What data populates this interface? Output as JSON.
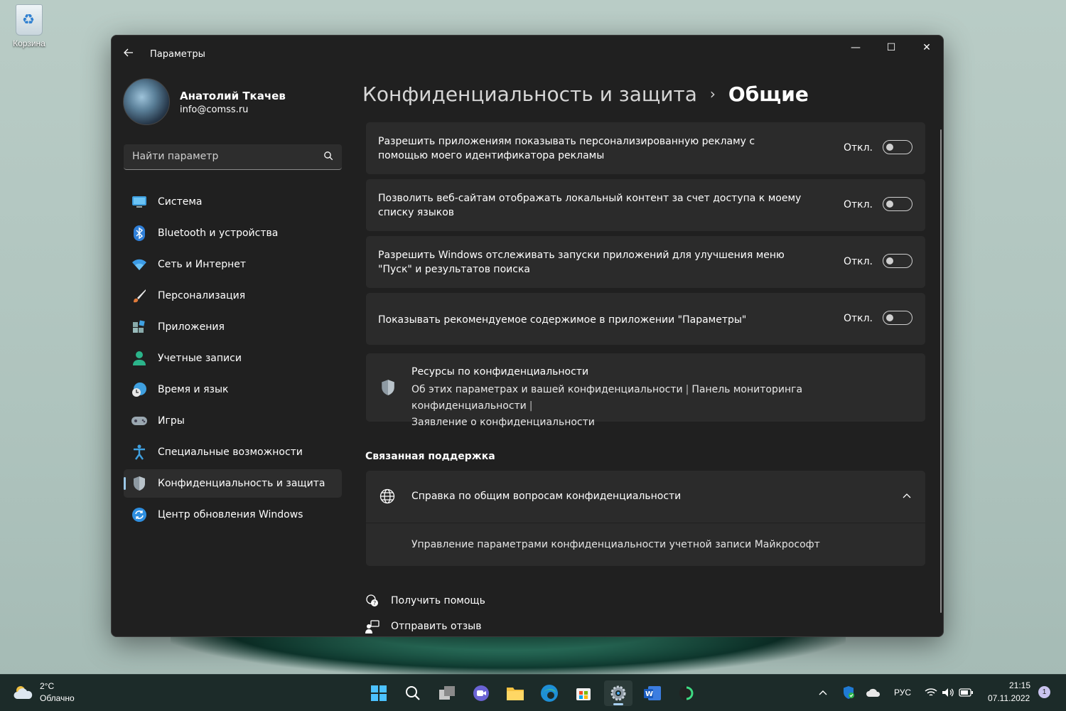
{
  "desktop": {
    "recycle_bin_label": "Корзина"
  },
  "window": {
    "title": "Параметры",
    "controls": {
      "minimize": "—",
      "maximize": "☐",
      "close": "✕"
    }
  },
  "profile": {
    "name": "Анатолий Ткачев",
    "email": "info@comss.ru"
  },
  "search": {
    "placeholder": "Найти параметр"
  },
  "sidebar": {
    "items": [
      {
        "label": "Система",
        "icon": "monitor-icon"
      },
      {
        "label": "Bluetooth и устройства",
        "icon": "bluetooth-icon"
      },
      {
        "label": "Сеть и Интернет",
        "icon": "wifi-icon"
      },
      {
        "label": "Персонализация",
        "icon": "brush-icon"
      },
      {
        "label": "Приложения",
        "icon": "apps-icon"
      },
      {
        "label": "Учетные записи",
        "icon": "person-icon"
      },
      {
        "label": "Время и язык",
        "icon": "globe-clock-icon"
      },
      {
        "label": "Игры",
        "icon": "gamepad-icon"
      },
      {
        "label": "Специальные возможности",
        "icon": "accessibility-icon"
      },
      {
        "label": "Конфиденциальность и защита",
        "icon": "shield-icon",
        "active": true
      },
      {
        "label": "Центр обновления Windows",
        "icon": "update-icon"
      }
    ]
  },
  "breadcrumb": {
    "parent": "Конфиденциальность и защита",
    "separator": "›",
    "current": "Общие"
  },
  "settings": [
    {
      "text": "Разрешить приложениям показывать персонализированную рекламу с помощью моего идентификатора рекламы",
      "state": "Откл.",
      "on": false
    },
    {
      "text": "Позволить веб-сайтам отображать локальный контент за счет доступа к моему списку языков",
      "state": "Откл.",
      "on": false
    },
    {
      "text": "Разрешить Windows отслеживать запуски приложений для улучшения меню \"Пуск\" и результатов поиска",
      "state": "Откл.",
      "on": false
    },
    {
      "text": "Показывать рекомендуемое содержимое в приложении \"Параметры\"",
      "state": "Откл.",
      "on": false
    }
  ],
  "resources": {
    "title": "Ресурсы по конфиденциальности",
    "links": [
      "Об этих параметрах и вашей конфиденциальности",
      "Панель мониторинга конфиденциальности",
      "Заявление о конфиденциальности"
    ],
    "pipe": "|"
  },
  "related_support": {
    "section_title": "Связанная поддержка",
    "help_title": "Справка по общим вопросам конфиденциальности",
    "help_link": "Управление параметрами конфиденциальности учетной записи Майкрософт"
  },
  "footer_links": {
    "get_help": "Получить помощь",
    "feedback": "Отправить отзыв"
  },
  "taskbar": {
    "weather_temp": "2°C",
    "weather_desc": "Облачно",
    "language": "РУС",
    "time": "21:15",
    "date": "07.11.2022",
    "notifications": "1",
    "apps": [
      "start-icon",
      "search-icon",
      "task-view-icon",
      "teams-icon",
      "explorer-icon",
      "edge-icon",
      "store-icon",
      "settings-icon",
      "word-icon",
      "app-icon"
    ]
  },
  "colors": {
    "accent": "#9cc8e8",
    "window_bg": "#202020",
    "card_bg": "#2b2b2b"
  }
}
